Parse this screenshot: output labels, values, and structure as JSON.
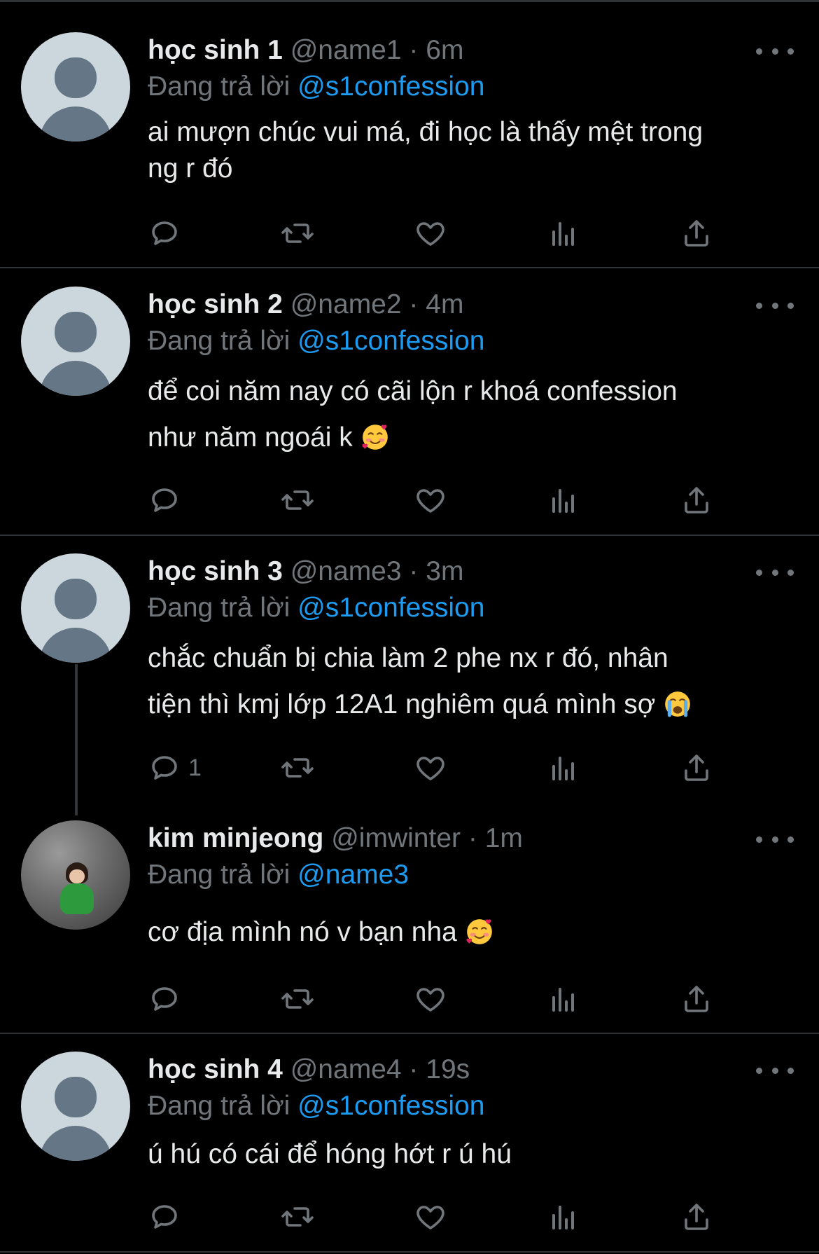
{
  "reply_prefix": "Đang trả lời",
  "colors": {
    "background": "#000000",
    "text": "#e7e9ea",
    "secondary": "#71767b",
    "link": "#1d9bf0",
    "divider": "#2f3336"
  },
  "tweets": [
    {
      "name": "học sinh 1",
      "handle": "@name1",
      "sep": "·",
      "time": "6m",
      "reply_to": "@s1confession",
      "text": [
        "ai mượn chúc vui má, đi học là thấy mệt trong",
        "ng r đó"
      ],
      "reply_count": "",
      "avatar": "default-avatar-icon"
    },
    {
      "name": "học sinh 2",
      "handle": "@name2",
      "sep": "·",
      "time": "4m",
      "reply_to": "@s1confession",
      "text": [
        "để coi năm nay có cãi lộn r khoá confession",
        "như năm ngoái k"
      ],
      "emoji": "smiling-face-with-hearts",
      "reply_count": "",
      "avatar": "default-avatar-icon"
    },
    {
      "name": "học sinh 3",
      "handle": "@name3",
      "sep": "·",
      "time": "3m",
      "reply_to": "@s1confession",
      "text": [
        "chắc chuẩn bị chia làm 2 phe nx r đó, nhân",
        "tiện thì kmj lớp 12A1 nghiêm quá mình sợ"
      ],
      "emoji": "loudly-crying-face",
      "reply_count": "1",
      "avatar": "default-avatar-icon"
    },
    {
      "name": "kim minjeong",
      "handle": "@imwinter",
      "sep": "·",
      "time": "1m",
      "reply_to": "@name3",
      "text": [
        "cơ địa mình nó v bạn nha"
      ],
      "emoji": "smiling-face-with-hearts",
      "reply_count": "",
      "avatar": "profile-photo"
    },
    {
      "name": "học sinh 4",
      "handle": "@name4",
      "sep": "·",
      "time": "19s",
      "reply_to": "@s1confession",
      "text": [
        "ú hú có cái để hóng hớt r ú hú"
      ],
      "reply_count": "",
      "avatar": "default-avatar-icon"
    }
  ]
}
